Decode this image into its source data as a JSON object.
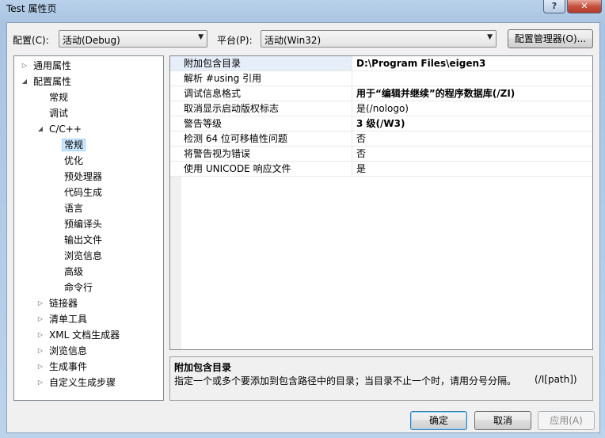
{
  "window": {
    "title": "Test 属性页",
    "help_glyph": "?",
    "close_glyph": "✕"
  },
  "toolbar": {
    "config_label": "配置(C):",
    "config_value": "活动(Debug)",
    "platform_label": "平台(P):",
    "platform_value": "活动(Win32)",
    "config_manager_label": "配置管理器(O)..."
  },
  "tree": {
    "items": [
      {
        "label": "通用属性",
        "glyph": "▷"
      },
      {
        "label": "配置属性",
        "glyph": "◢"
      },
      {
        "label": "常规"
      },
      {
        "label": "调试"
      },
      {
        "label": "C/C++",
        "glyph": "◢"
      },
      {
        "label": "常规"
      },
      {
        "label": "优化"
      },
      {
        "label": "预处理器"
      },
      {
        "label": "代码生成"
      },
      {
        "label": "语言"
      },
      {
        "label": "预编译头"
      },
      {
        "label": "输出文件"
      },
      {
        "label": "浏览信息"
      },
      {
        "label": "高级"
      },
      {
        "label": "命令行"
      },
      {
        "label": "链接器",
        "glyph": "▷"
      },
      {
        "label": "清单工具",
        "glyph": "▷"
      },
      {
        "label": "XML 文档生成器",
        "glyph": "▷"
      },
      {
        "label": "浏览信息",
        "glyph": "▷"
      },
      {
        "label": "生成事件",
        "glyph": "▷"
      },
      {
        "label": "自定义生成步骤",
        "glyph": "▷"
      }
    ]
  },
  "properties": [
    {
      "name": "附加包含目录",
      "value": "D:\\Program Files\\eigen3"
    },
    {
      "name": "解析 #using 引用",
      "value": ""
    },
    {
      "name": "调试信息格式",
      "value": "用于“编辑并继续”的程序数据库(/ZI)"
    },
    {
      "name": "取消显示启动版权标志",
      "value": "是(/nologo)"
    },
    {
      "name": "警告等级",
      "value": "3 级(/W3)"
    },
    {
      "name": "检测 64 位可移植性问题",
      "value": "否"
    },
    {
      "name": "将警告视为错误",
      "value": "否"
    },
    {
      "name": "使用 UNICODE 响应文件",
      "value": "是"
    }
  ],
  "description": {
    "title": "附加包含目录",
    "text": "指定一个或多个要添加到包含路径中的目录；当目录不止一个时，请用分号分隔。",
    "switch": "(/I[path])"
  },
  "buttons": {
    "ok": "确定",
    "cancel": "取消",
    "apply": "应用(A)"
  }
}
